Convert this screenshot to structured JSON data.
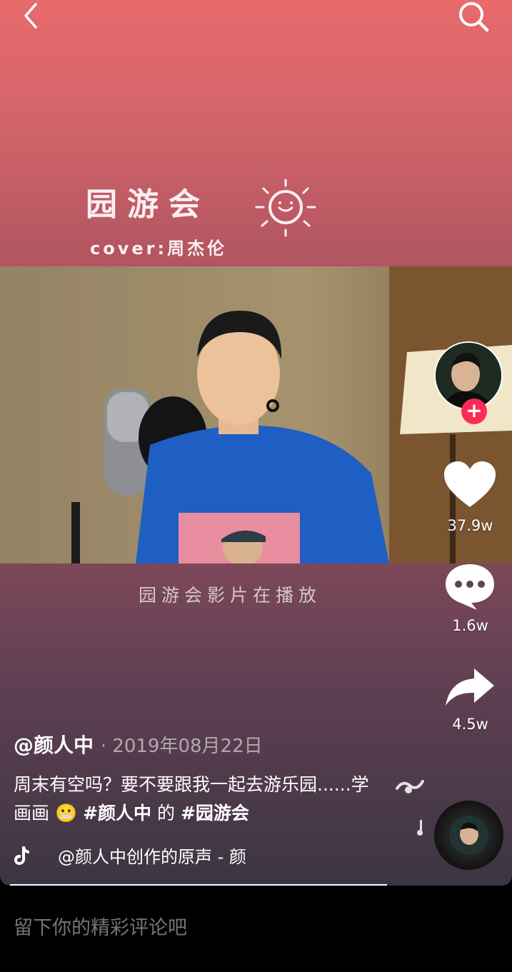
{
  "top_bar": {
    "back_icon": "chevron-left-icon",
    "search_icon": "search-icon"
  },
  "video": {
    "title": "园游会",
    "cover": "cover:周杰伦",
    "overlay_caption": "园游会影片在播放"
  },
  "rail": {
    "like_count": "37.9w",
    "comment_count": "1.6w",
    "share_count": "4.5w",
    "follow_label": "+"
  },
  "post": {
    "author": "@颜人中",
    "date": "· 2019年08月22日",
    "description": "周末有空吗？要不要跟我一起去游乐园......学画画",
    "emoji": "😬",
    "tag1": "#颜人中",
    "connector": "的",
    "tag2": "#园游会",
    "music": "@颜人中创作的原声 - 颜"
  },
  "comment": {
    "placeholder": "留下你的精彩评论吧"
  },
  "colors": {
    "accent": "#fe2c55",
    "background": "#000000"
  }
}
